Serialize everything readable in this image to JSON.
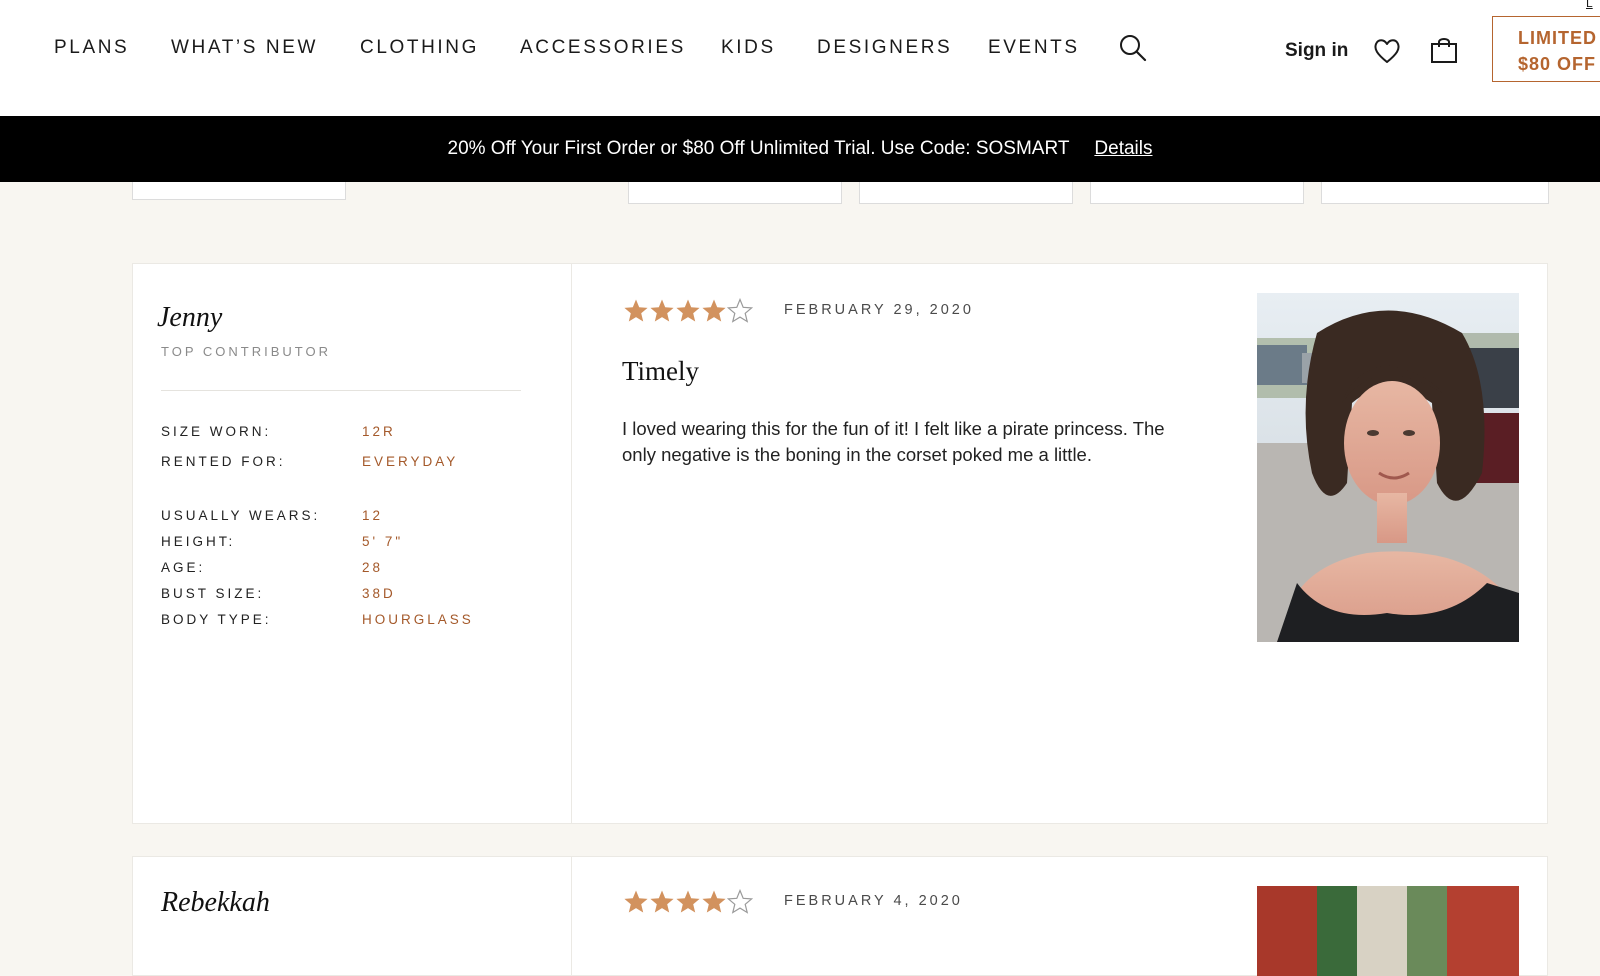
{
  "nav": {
    "items": [
      "PLANS",
      "WHAT’S NEW",
      "CLOTHING",
      "ACCESSORIES",
      "KIDS",
      "DESIGNERS",
      "EVENTS"
    ],
    "signin": "Sign in",
    "promo_line1": "LIMITED",
    "promo_line2": "$80 OFF",
    "promo_link": "L"
  },
  "icons": [
    "search-icon",
    "heart-icon",
    "shopping-bag-icon",
    "star-icon"
  ],
  "banner": {
    "text": "20% Off Your First Order or $80 Off Unlimited Trial. Use Code: SOSMART",
    "link": "Details"
  },
  "colors": {
    "accent": "#a4592a",
    "star": "#d2925e",
    "banner_bg": "#000000",
    "page_bg": "#f8f6f1"
  },
  "reviews": [
    {
      "name": "Jenny",
      "badge": "TOP CONTRIBUTOR",
      "stats": [
        {
          "label": "SIZE WORN:",
          "value": "12R"
        },
        {
          "label": "RENTED FOR:",
          "value": "EVERYDAY"
        },
        {
          "label": "USUALLY WEARS:",
          "value": "12"
        },
        {
          "label": "HEIGHT:",
          "value": "5' 7\""
        },
        {
          "label": "AGE:",
          "value": "28"
        },
        {
          "label": "BUST SIZE:",
          "value": "38D"
        },
        {
          "label": "BODY TYPE:",
          "value": "HOURGLASS"
        }
      ],
      "rating": 4,
      "rating_max": 5,
      "date": "FEBRUARY 29, 2020",
      "title": "Timely",
      "body": "I loved wearing this for the fun of it! I felt like a pirate princess. The only negative is the boning in the corset poked me a little."
    },
    {
      "name": "Rebekkah",
      "rating": 4,
      "rating_max": 5,
      "date": "FEBRUARY 4, 2020"
    }
  ]
}
